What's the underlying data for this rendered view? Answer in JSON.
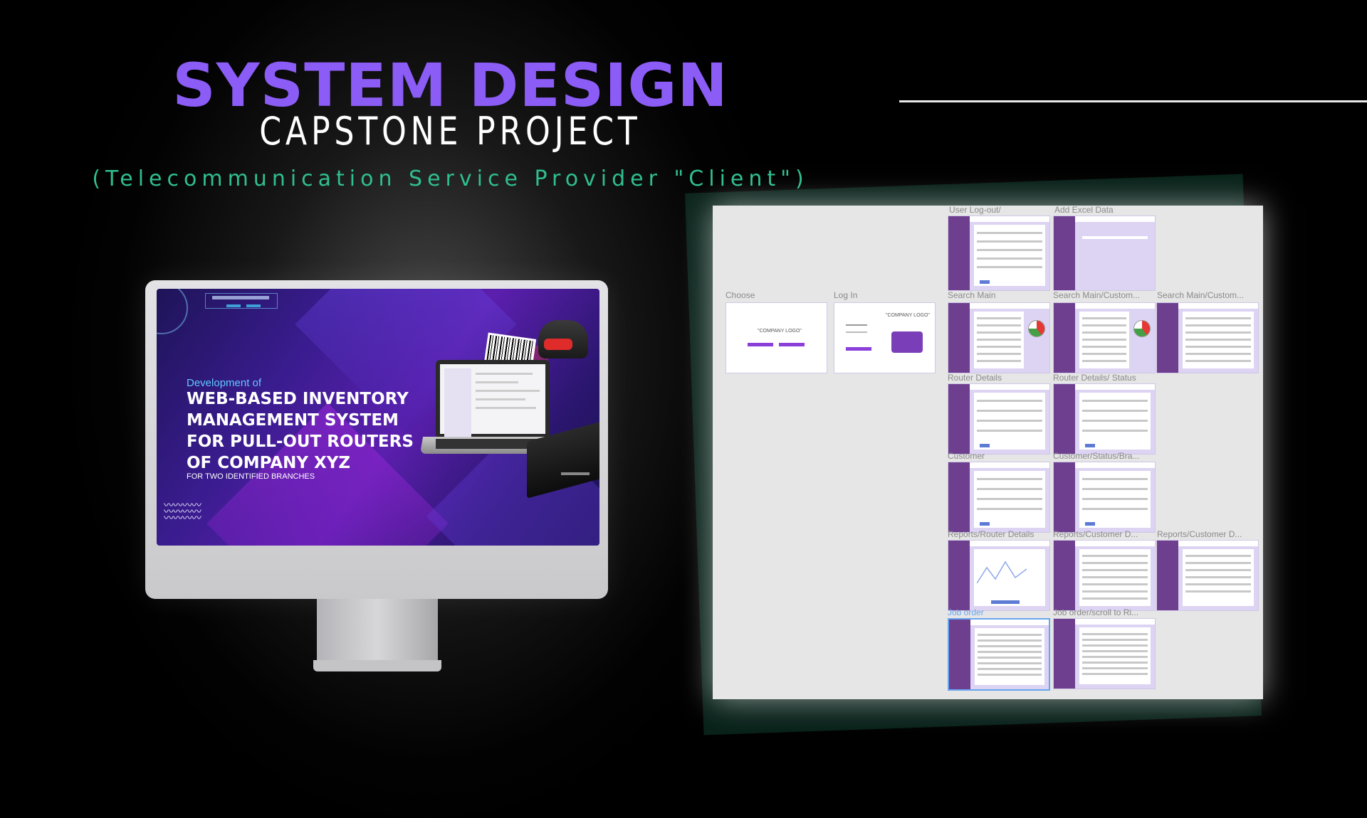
{
  "header": {
    "title": "SYSTEM DESIGN",
    "subtitle": "CAPSTONE PROJECT",
    "client": "(Telecommunication Service Provider \"Client\")"
  },
  "colors": {
    "title_purple": "#8b5cf6",
    "client_green": "#2fbf8f",
    "background": "#000000",
    "sidebar_purple": "#6d3f8e"
  },
  "monitor": {
    "development_of": "Development of",
    "headline_lines": [
      "WEB-BASED INVENTORY",
      "MANAGEMENT SYSTEM",
      "FOR PULL-OUT ROUTERS",
      "OF COMPANY XYZ"
    ],
    "subline": "FOR TWO IDENTIFIED BRANCHES"
  },
  "board": {
    "frames": [
      {
        "label": "User Log-out/"
      },
      {
        "label": "Add Excel Data"
      },
      {
        "label": "Choose"
      },
      {
        "label": "Log In"
      },
      {
        "label": "Search Main"
      },
      {
        "label": "Search Main/Custom..."
      },
      {
        "label": "Search Main/Custom..."
      },
      {
        "label": "Router Details"
      },
      {
        "label": "Router Details/ Status"
      },
      {
        "label": "Customer"
      },
      {
        "label": "Customer/Status/Bra..."
      },
      {
        "label": "Reports/Router Details"
      },
      {
        "label": "Reports/Customer D..."
      },
      {
        "label": "Reports/Customer D..."
      },
      {
        "label": "Job order"
      },
      {
        "label": "Job order/scroll to Ri..."
      }
    ],
    "choose_card_text": "\"COMPANY LOGO\"",
    "login_card_text": "\"COMPANY LOGO\""
  }
}
